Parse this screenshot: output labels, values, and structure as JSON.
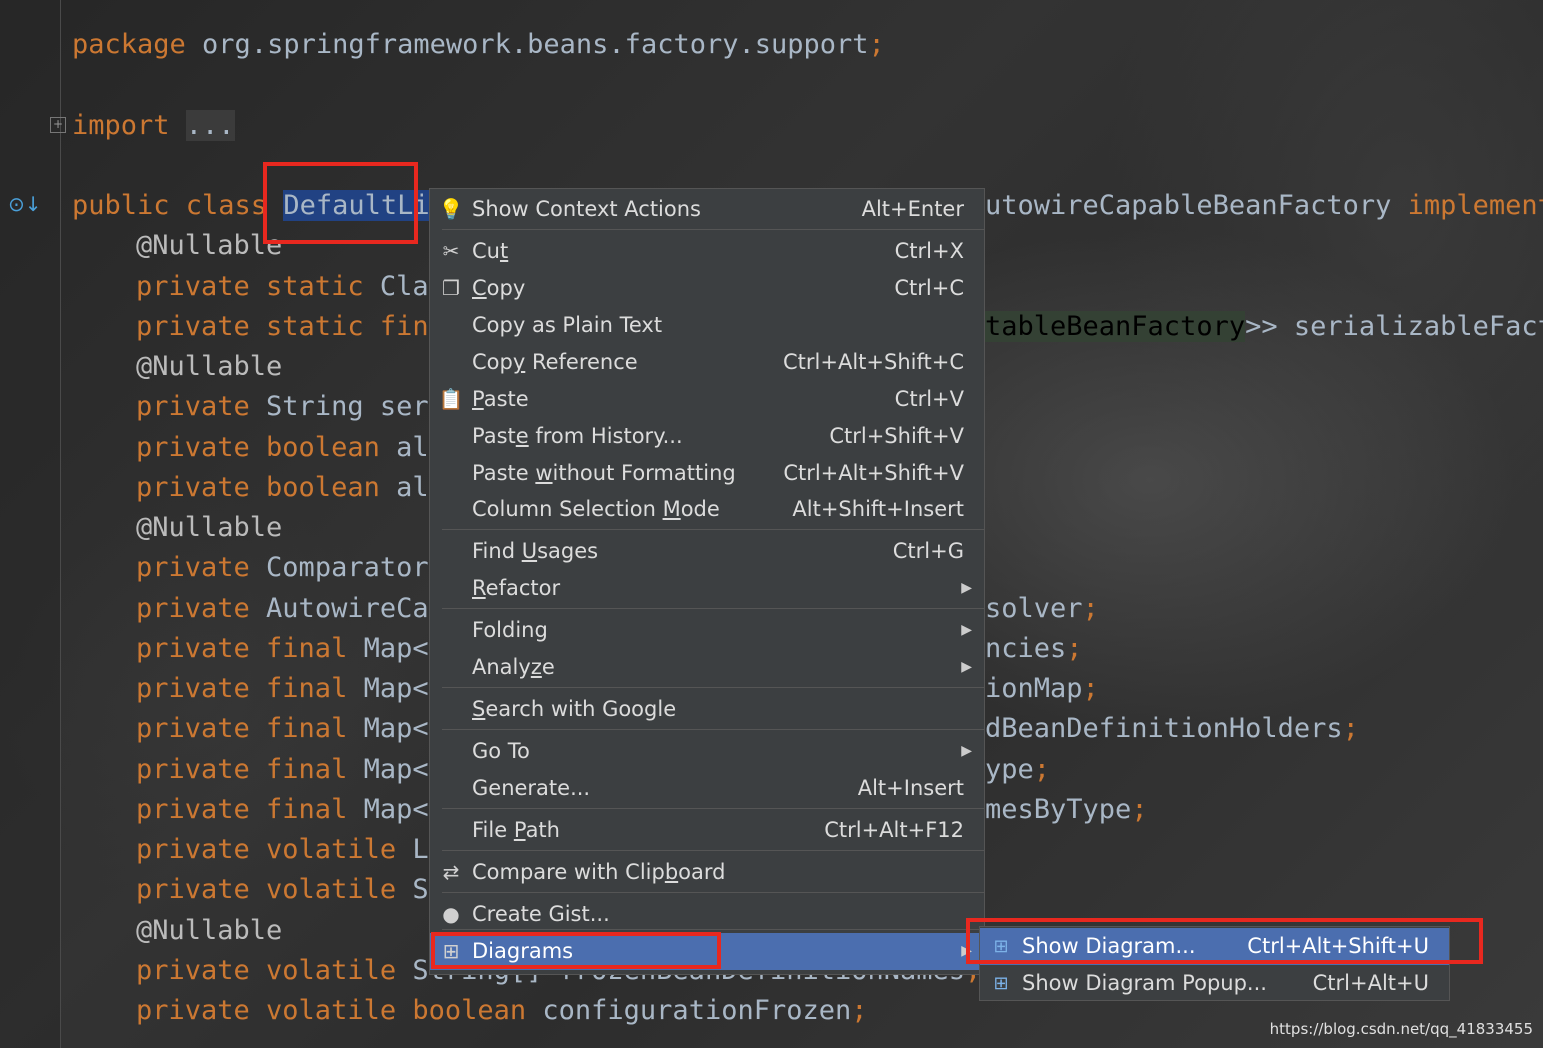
{
  "editor": {
    "lines": [
      {
        "parts": [
          [
            "kw",
            "package "
          ],
          [
            "pl",
            "org.springframework.beans.factory.support"
          ],
          [
            "kw",
            ";"
          ]
        ]
      },
      {
        "parts": [
          [
            "kw",
            "import "
          ],
          [
            "fold",
            "..."
          ]
        ]
      },
      {
        "parts": [
          [
            "kw",
            "public class "
          ],
          [
            "sel",
            "DefaultLis"
          ]
        ]
      },
      {
        "parts": [
          [
            "ann",
            "@Nullable"
          ]
        ]
      },
      {
        "parts": [
          [
            "kw",
            "private static "
          ],
          [
            "pl",
            "Clas"
          ]
        ]
      },
      {
        "parts": [
          [
            "kw",
            "private static fina"
          ]
        ]
      },
      {
        "parts": [
          [
            "ann",
            "@Nullable"
          ]
        ]
      },
      {
        "parts": [
          [
            "kw",
            "private "
          ],
          [
            "pl",
            "String ser"
          ]
        ]
      },
      {
        "parts": [
          [
            "kw",
            "private boolean "
          ],
          [
            "pl",
            "al"
          ]
        ]
      },
      {
        "parts": [
          [
            "kw",
            "private boolean "
          ],
          [
            "pl",
            "al"
          ]
        ]
      },
      {
        "parts": [
          [
            "ann",
            "@Nullable"
          ]
        ]
      },
      {
        "parts": [
          [
            "kw",
            "private "
          ],
          [
            "pl",
            "Comparator<"
          ]
        ]
      },
      {
        "parts": [
          [
            "kw",
            "private "
          ],
          [
            "pl",
            "AutowireCan"
          ]
        ]
      },
      {
        "parts": [
          [
            "kw",
            "private final "
          ],
          [
            "pl",
            "Map<("
          ]
        ]
      },
      {
        "parts": [
          [
            "kw",
            "private final "
          ],
          [
            "pl",
            "Map<S"
          ]
        ]
      },
      {
        "parts": [
          [
            "kw",
            "private final "
          ],
          [
            "pl",
            "Map<S"
          ]
        ]
      },
      {
        "parts": [
          [
            "kw",
            "private final "
          ],
          [
            "pl",
            "Map<("
          ]
        ]
      },
      {
        "parts": [
          [
            "kw",
            "private final "
          ],
          [
            "pl",
            "Map<("
          ]
        ]
      },
      {
        "parts": [
          [
            "kw",
            "private volatile "
          ],
          [
            "pl",
            "Li"
          ]
        ]
      },
      {
        "parts": [
          [
            "kw",
            "private volatile "
          ],
          [
            "pl",
            "Se"
          ]
        ]
      },
      {
        "parts": [
          [
            "ann",
            "@Nullable"
          ]
        ]
      },
      {
        "parts": [
          [
            "kw",
            "private volatile "
          ],
          [
            "pl",
            "String[] frozenBeanDefinitionNames"
          ],
          [
            "kw",
            ";"
          ]
        ]
      },
      {
        "parts": [
          [
            "kw",
            "private volatile boolean "
          ],
          [
            "pl",
            "configurationFrozen"
          ],
          [
            "kw",
            ";"
          ]
        ]
      }
    ],
    "right_fragments": [
      {
        "parts": [
          [
            "pl",
            "utowireCapableBeanFactory "
          ],
          [
            "kw",
            "implement"
          ]
        ]
      },
      {
        "parts": [
          [
            "hl",
            "tableBeanFactory"
          ],
          [
            "pl",
            ">> serializableFact"
          ]
        ]
      },
      {
        "parts": [
          [
            "pl",
            "solver"
          ],
          [
            "kw",
            ";"
          ]
        ]
      },
      {
        "parts": [
          [
            "pl",
            "ncies"
          ],
          [
            "kw",
            ";"
          ]
        ]
      },
      {
        "parts": [
          [
            "pl",
            "ionMap"
          ],
          [
            "kw",
            ";"
          ]
        ]
      },
      {
        "parts": [
          [
            "pl",
            "dBeanDefinitionHolders"
          ],
          [
            "kw",
            ";"
          ]
        ]
      },
      {
        "parts": [
          [
            "pl",
            "ype"
          ],
          [
            "kw",
            ";"
          ]
        ]
      },
      {
        "parts": [
          [
            "pl",
            "mesByType"
          ],
          [
            "kw",
            ";"
          ]
        ]
      }
    ]
  },
  "context_menu": {
    "items": [
      {
        "icon": "lightbulb-icon",
        "glyph": "💡",
        "label": "Show Context Actions",
        "mnemonic": "",
        "shortcut": "Alt+Enter"
      },
      {
        "icon": "scissors-icon",
        "glyph": "✂",
        "label": "Cut",
        "mnemonic": "t",
        "shortcut": "Ctrl+X"
      },
      {
        "icon": "copy-icon",
        "glyph": "❐",
        "label": "Copy",
        "mnemonic": "C",
        "shortcut": "Ctrl+C"
      },
      {
        "icon": "",
        "glyph": "",
        "label": "Copy as Plain Text",
        "mnemonic": "",
        "shortcut": ""
      },
      {
        "icon": "",
        "glyph": "",
        "label": "Copy Reference",
        "mnemonic": "y",
        "shortcut": "Ctrl+Alt+Shift+C"
      },
      {
        "icon": "clipboard-icon",
        "glyph": "📋",
        "label": "Paste",
        "mnemonic": "P",
        "shortcut": "Ctrl+V"
      },
      {
        "icon": "",
        "glyph": "",
        "label": "Paste from History...",
        "mnemonic": "e",
        "shortcut": "Ctrl+Shift+V"
      },
      {
        "icon": "",
        "glyph": "",
        "label": "Paste without Formatting",
        "mnemonic": "w",
        "shortcut": "Ctrl+Alt+Shift+V"
      },
      {
        "icon": "",
        "glyph": "",
        "label": "Column Selection Mode",
        "mnemonic": "M",
        "shortcut": "Alt+Shift+Insert"
      },
      {
        "icon": "",
        "glyph": "",
        "label": "Find Usages",
        "mnemonic": "U",
        "shortcut": "Ctrl+G"
      },
      {
        "icon": "",
        "glyph": "",
        "label": "Refactor",
        "mnemonic": "R",
        "shortcut": "",
        "submenu": true
      },
      {
        "icon": "",
        "glyph": "",
        "label": "Folding",
        "mnemonic": "",
        "shortcut": "",
        "submenu": true
      },
      {
        "icon": "",
        "glyph": "",
        "label": "Analyze",
        "mnemonic": "z",
        "shortcut": "",
        "submenu": true
      },
      {
        "icon": "",
        "glyph": "",
        "label": "Search with Google",
        "mnemonic": "S",
        "shortcut": ""
      },
      {
        "icon": "",
        "glyph": "",
        "label": "Go To",
        "mnemonic": "",
        "shortcut": "",
        "submenu": true
      },
      {
        "icon": "",
        "glyph": "",
        "label": "Generate...",
        "mnemonic": "",
        "shortcut": "Alt+Insert"
      },
      {
        "icon": "",
        "glyph": "",
        "label": "File Path",
        "mnemonic": "P",
        "shortcut": "Ctrl+Alt+F12"
      },
      {
        "icon": "compare-icon",
        "glyph": "⇄",
        "label": "Compare with Clipboard",
        "mnemonic": "b",
        "shortcut": ""
      },
      {
        "icon": "github-icon",
        "glyph": "●",
        "label": "Create Gist...",
        "mnemonic": "",
        "shortcut": ""
      },
      {
        "icon": "diagram-icon",
        "glyph": "⊞",
        "label": "Diagrams",
        "mnemonic": "",
        "shortcut": "",
        "submenu": true,
        "active": true
      }
    ]
  },
  "submenu": {
    "items": [
      {
        "icon": "diagram-icon",
        "glyph": "⊞",
        "label": "Show Diagram...",
        "shortcut": "Ctrl+Alt+Shift+U",
        "active": true
      },
      {
        "icon": "diagram-icon",
        "glyph": "⊞",
        "label": "Show Diagram Popup...",
        "shortcut": "Ctrl+Alt+U"
      }
    ]
  },
  "watermark": "https://blog.csdn.net/qq_41833455",
  "colors": {
    "keyword": "#cc7832",
    "plain": "#a9b7c6",
    "annotation": "#bbbbbb",
    "menu_bg": "#3c3f41",
    "menu_active": "#4b6eaf",
    "highlight_box": "#e8281f"
  }
}
